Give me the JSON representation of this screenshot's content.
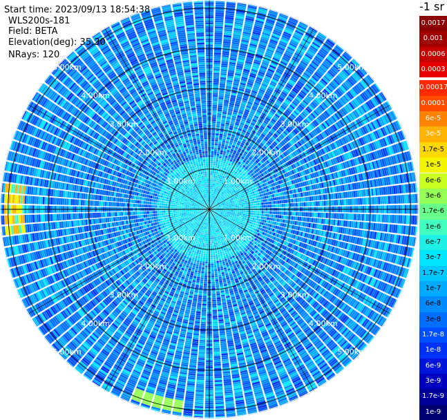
{
  "header": {
    "start_time": "Start time: 2023/09/13 18:54:38",
    "instrument": "WLS200s-181",
    "field": "Field: BETA",
    "elevation": "Elevation(deg): 35.30",
    "nrays": "NRays: 120"
  },
  "colorbar": {
    "unit_label": "-1 sr",
    "entries": [
      {
        "label": "0.0017",
        "color": "#8b0000"
      },
      {
        "label": "0.001",
        "color": "#a00000"
      },
      {
        "label": "0.0006",
        "color": "#c40000"
      },
      {
        "label": "0.0003",
        "color": "#e60000"
      },
      {
        "label": "0.00017",
        "color": "#ff2a00"
      },
      {
        "label": "0.0001",
        "color": "#ff4c00"
      },
      {
        "label": "6e-5",
        "color": "#ff8200"
      },
      {
        "label": "3e-5",
        "color": "#ffb200"
      },
      {
        "label": "1.7e-5",
        "color": "#ffd800"
      },
      {
        "label": "1e-5",
        "color": "#f2f500"
      },
      {
        "label": "6e-6",
        "color": "#c8ff1e"
      },
      {
        "label": "3e-6",
        "color": "#96ff55"
      },
      {
        "label": "1.7e-6",
        "color": "#69ff8d"
      },
      {
        "label": "1e-6",
        "color": "#41ffc0"
      },
      {
        "label": "6e-7",
        "color": "#1ef0e6"
      },
      {
        "label": "3e-7",
        "color": "#00e6ff"
      },
      {
        "label": "1.7e-7",
        "color": "#00c8ff"
      },
      {
        "label": "1e-7",
        "color": "#00aaff"
      },
      {
        "label": "6e-8",
        "color": "#008cff"
      },
      {
        "label": "3e-8",
        "color": "#006eff"
      },
      {
        "label": "1.7e-8",
        "color": "#0050ff"
      },
      {
        "label": "1e-8",
        "color": "#0032f5"
      },
      {
        "label": "6e-9",
        "color": "#0014dc"
      },
      {
        "label": "3e-9",
        "color": "#0000be"
      },
      {
        "label": "1.7e-9",
        "color": "#00009b"
      },
      {
        "label": "1e-9",
        "color": "#000070"
      }
    ]
  },
  "chart_data": {
    "type": "heatmap",
    "projection": "polar-ppi",
    "n_rays": 120,
    "range_rings": [
      {
        "range_km": 1.0,
        "label": "1.00km"
      },
      {
        "range_km": 2.0,
        "label": "2.00km"
      },
      {
        "range_km": 3.0,
        "label": "3.00km"
      },
      {
        "range_km": 4.0,
        "label": "4.00km"
      },
      {
        "range_km": 5.0,
        "label": "5.00km"
      }
    ],
    "max_range_km": 5.2,
    "radial_lines_every_deg": 30,
    "gate_spacing_km": 0.05,
    "dominant_range": [
      "3e-8",
      "1e-7"
    ],
    "highlights": [
      {
        "azimuth_deg": 270,
        "range_km": [
          4.6,
          5.1
        ],
        "levels": [
          "3e-5",
          "1e-5",
          "1e-6"
        ]
      },
      {
        "azimuth_deg": 195,
        "range_km": [
          4.8,
          5.1
        ],
        "levels": [
          "3e-6"
        ]
      }
    ]
  }
}
